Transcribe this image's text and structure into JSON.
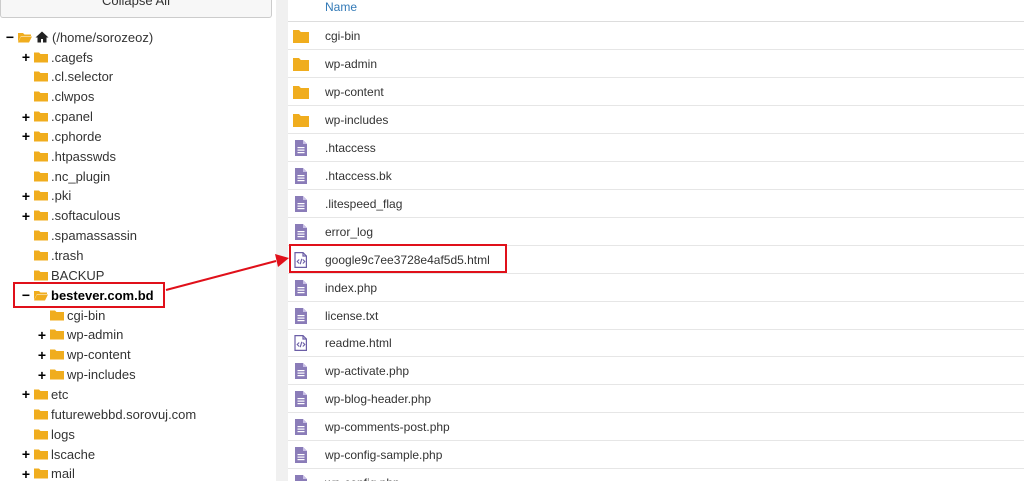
{
  "tree": {
    "collapse_all_label": "Collapse All",
    "root_label": "(/home/sorozeoz)",
    "items": [
      {
        "label": ".cagefs",
        "toggle": "+"
      },
      {
        "label": ".cl.selector",
        "toggle": ""
      },
      {
        "label": ".clwpos",
        "toggle": ""
      },
      {
        "label": ".cpanel",
        "toggle": "+"
      },
      {
        "label": ".cphorde",
        "toggle": "+"
      },
      {
        "label": ".htpasswds",
        "toggle": ""
      },
      {
        "label": ".nc_plugin",
        "toggle": ""
      },
      {
        "label": ".pki",
        "toggle": "+"
      },
      {
        "label": ".softaculous",
        "toggle": "+"
      },
      {
        "label": ".spamassassin",
        "toggle": ""
      },
      {
        "label": ".trash",
        "toggle": ""
      },
      {
        "label": "BACKUP",
        "toggle": ""
      },
      {
        "label": "bestever.com.bd",
        "toggle": "−"
      },
      {
        "label": "cgi-bin",
        "toggle": ""
      },
      {
        "label": "wp-admin",
        "toggle": "+"
      },
      {
        "label": "wp-content",
        "toggle": "+"
      },
      {
        "label": "wp-includes",
        "toggle": "+"
      },
      {
        "label": "etc",
        "toggle": "+"
      },
      {
        "label": "futurewebbd.sorovuj.com",
        "toggle": ""
      },
      {
        "label": "logs",
        "toggle": ""
      },
      {
        "label": "lscache",
        "toggle": "+"
      },
      {
        "label": "mail",
        "toggle": "+"
      }
    ]
  },
  "files": {
    "column_header": "Name",
    "rows": [
      {
        "name": "cgi-bin",
        "icon": "folder-icon"
      },
      {
        "name": "wp-admin",
        "icon": "folder-icon"
      },
      {
        "name": "wp-content",
        "icon": "folder-icon"
      },
      {
        "name": "wp-includes",
        "icon": "folder-icon"
      },
      {
        "name": ".htaccess",
        "icon": "text-file-icon"
      },
      {
        "name": ".htaccess.bk",
        "icon": "text-file-icon"
      },
      {
        "name": ".litespeed_flag",
        "icon": "text-file-icon"
      },
      {
        "name": "error_log",
        "icon": "text-file-icon"
      },
      {
        "name": "google9c7ee3728e4af5d5.html",
        "icon": "code-file-icon"
      },
      {
        "name": "index.php",
        "icon": "text-file-icon"
      },
      {
        "name": "license.txt",
        "icon": "text-file-icon"
      },
      {
        "name": "readme.html",
        "icon": "code-file-icon"
      },
      {
        "name": "wp-activate.php",
        "icon": "text-file-icon"
      },
      {
        "name": "wp-blog-header.php",
        "icon": "text-file-icon"
      },
      {
        "name": "wp-comments-post.php",
        "icon": "text-file-icon"
      },
      {
        "name": "wp-config-sample.php",
        "icon": "text-file-icon"
      },
      {
        "name": "wp-config.php",
        "icon": "text-file-icon"
      }
    ]
  },
  "colors": {
    "folder": "#f0ad1e",
    "file": "#8a7cb8",
    "highlight": "#e0101a",
    "link": "#337ab7"
  }
}
